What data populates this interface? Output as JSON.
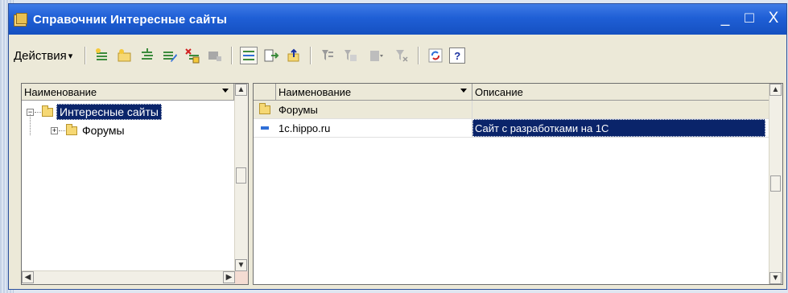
{
  "window": {
    "title": "Справочник Интересные сайты",
    "controls": {
      "minimize": "_",
      "maximize": "□",
      "close": "X"
    }
  },
  "toolbar": {
    "actions_label": "Действия",
    "actions_arrow": "▾",
    "help_label": "?"
  },
  "tree": {
    "header": "Наименование",
    "items": [
      {
        "label": "Интересные сайты",
        "expander": "−",
        "selected": true
      },
      {
        "label": "Форумы",
        "expander": "+",
        "selected": false
      }
    ]
  },
  "grid": {
    "columns": [
      "Наименование",
      "Описание"
    ],
    "rows": [
      {
        "name": "Форумы",
        "description": "",
        "kind": "folder"
      },
      {
        "name": "1c.hippo.ru",
        "description": "Сайт с разработками на 1С",
        "kind": "item"
      }
    ]
  },
  "colors": {
    "title_bar": "#1f5fd6",
    "selection": "#0a246a",
    "window_bg": "#ece9d8"
  }
}
